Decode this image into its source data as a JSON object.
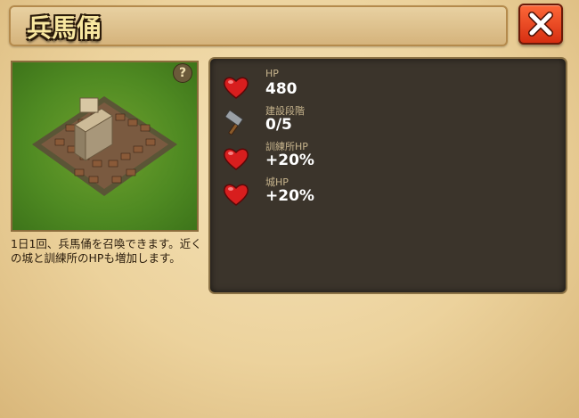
{
  "header": {
    "title": "兵馬俑"
  },
  "building": {
    "image": "terracotta-army-building",
    "help_icon": "question-icon",
    "help_glyph": "?",
    "description": "1日1回、兵馬俑を召喚できます。近くの城と訓練所のHPも増加します。"
  },
  "stats": [
    {
      "icon": "heart-icon",
      "label": "HP",
      "value": "480"
    },
    {
      "icon": "hammer-icon",
      "label": "建設段階",
      "value": "0/5"
    },
    {
      "icon": "heart-icon",
      "label": "訓練所HP",
      "value": "+20%"
    },
    {
      "icon": "heart-icon",
      "label": "城HP",
      "value": "+20%"
    }
  ],
  "colors": {
    "close_button": "#e8431c",
    "panel": "#3b342b",
    "heart": "#d81e1e"
  }
}
